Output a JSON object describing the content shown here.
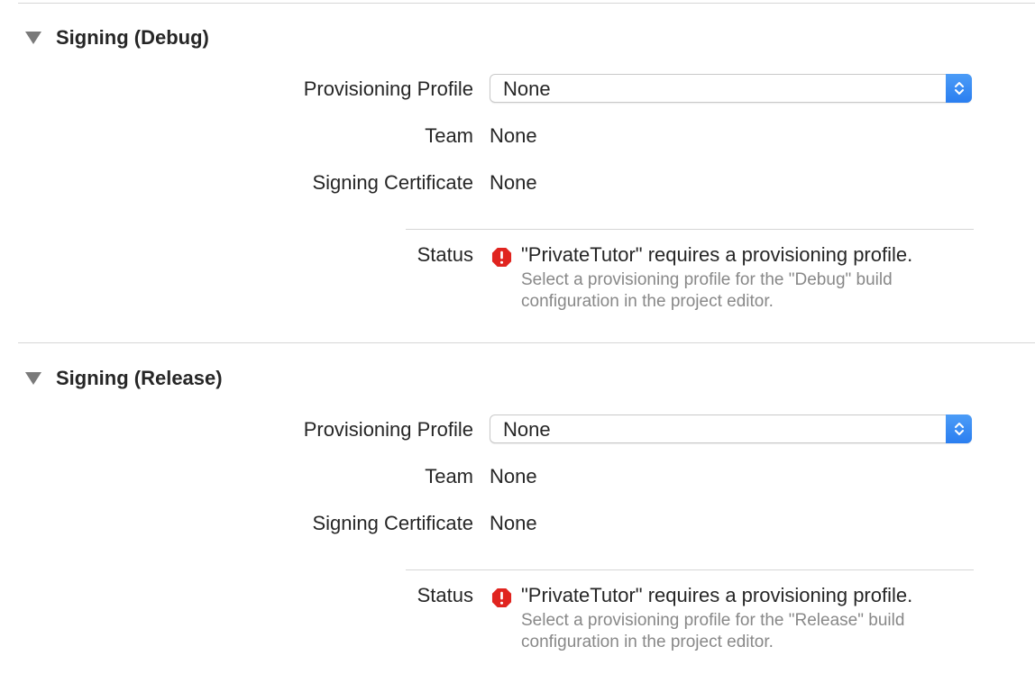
{
  "sections": [
    {
      "title": "Signing (Debug)",
      "provisioning_profile": {
        "label": "Provisioning Profile",
        "value": "None"
      },
      "team": {
        "label": "Team",
        "value": "None"
      },
      "signing_certificate": {
        "label": "Signing Certificate",
        "value": "None"
      },
      "status": {
        "label": "Status",
        "message": "\"PrivateTutor\" requires a provisioning profile.",
        "detail": "Select a provisioning profile for the \"Debug\" build configuration in the project editor."
      }
    },
    {
      "title": "Signing (Release)",
      "provisioning_profile": {
        "label": "Provisioning Profile",
        "value": "None"
      },
      "team": {
        "label": "Team",
        "value": "None"
      },
      "signing_certificate": {
        "label": "Signing Certificate",
        "value": "None"
      },
      "status": {
        "label": "Status",
        "message": "\"PrivateTutor\" requires a provisioning profile.",
        "detail": "Select a provisioning profile for the \"Release\" build configuration in the project editor."
      }
    }
  ],
  "icons": {
    "disclosure": "disclosure-triangle-down-icon",
    "stepper": "popup-chevron-updown-icon",
    "status": "error-octagon-icon"
  },
  "colors": {
    "accent": "#2a7ef0",
    "error": "#e0241f",
    "secondary_text": "#888888",
    "divider": "#d6d6d6"
  }
}
